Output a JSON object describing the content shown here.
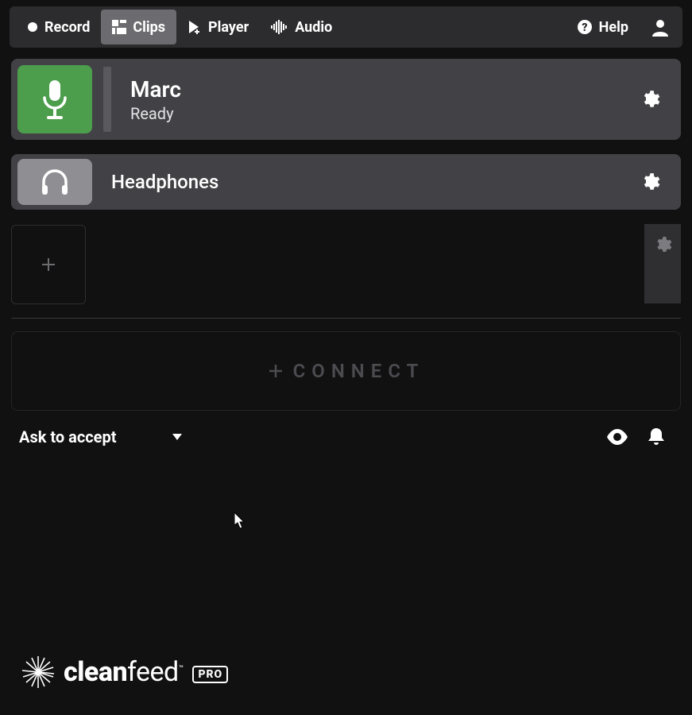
{
  "toolbar": {
    "record": "Record",
    "clips": "Clips",
    "player": "Player",
    "audio": "Audio",
    "help": "Help"
  },
  "channels": {
    "input": {
      "name": "Marc",
      "status": "Ready"
    },
    "output": {
      "name": "Headphones"
    }
  },
  "connect": {
    "label": "CONNECT"
  },
  "accept_mode": {
    "label": "Ask to accept"
  },
  "brand": {
    "name_a": "clean",
    "name_b": "feed",
    "badge": "PRO"
  }
}
